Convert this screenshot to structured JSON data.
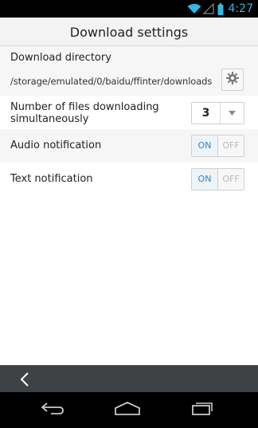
{
  "status_bar": {
    "time": "4:27",
    "wifi_icon": "wifi-icon",
    "signal_icon": "signal-icon",
    "battery_icon": "battery-icon",
    "accent_color": "#33b5e5"
  },
  "header": {
    "title": "Download settings"
  },
  "settings": {
    "directory": {
      "label": "Download directory",
      "path": "/storage/emulated/0/baidu/ffinter/downloads",
      "button_icon": "gear-icon"
    },
    "simultaneous": {
      "label_line1": "Number of files downloading",
      "label_line2": "simultaneously",
      "value": "3"
    },
    "audio_notification": {
      "label": "Audio notification",
      "on_label": "ON",
      "off_label": "OFF",
      "state": "ON"
    },
    "text_notification": {
      "label": "Text notification",
      "on_label": "ON",
      "off_label": "OFF",
      "state": "ON"
    }
  },
  "action_bar": {
    "back_icon": "chevron-left-icon"
  },
  "nav_bar": {
    "back_icon": "back-arrow-icon",
    "home_icon": "home-icon",
    "recents_icon": "recent-apps-icon"
  }
}
